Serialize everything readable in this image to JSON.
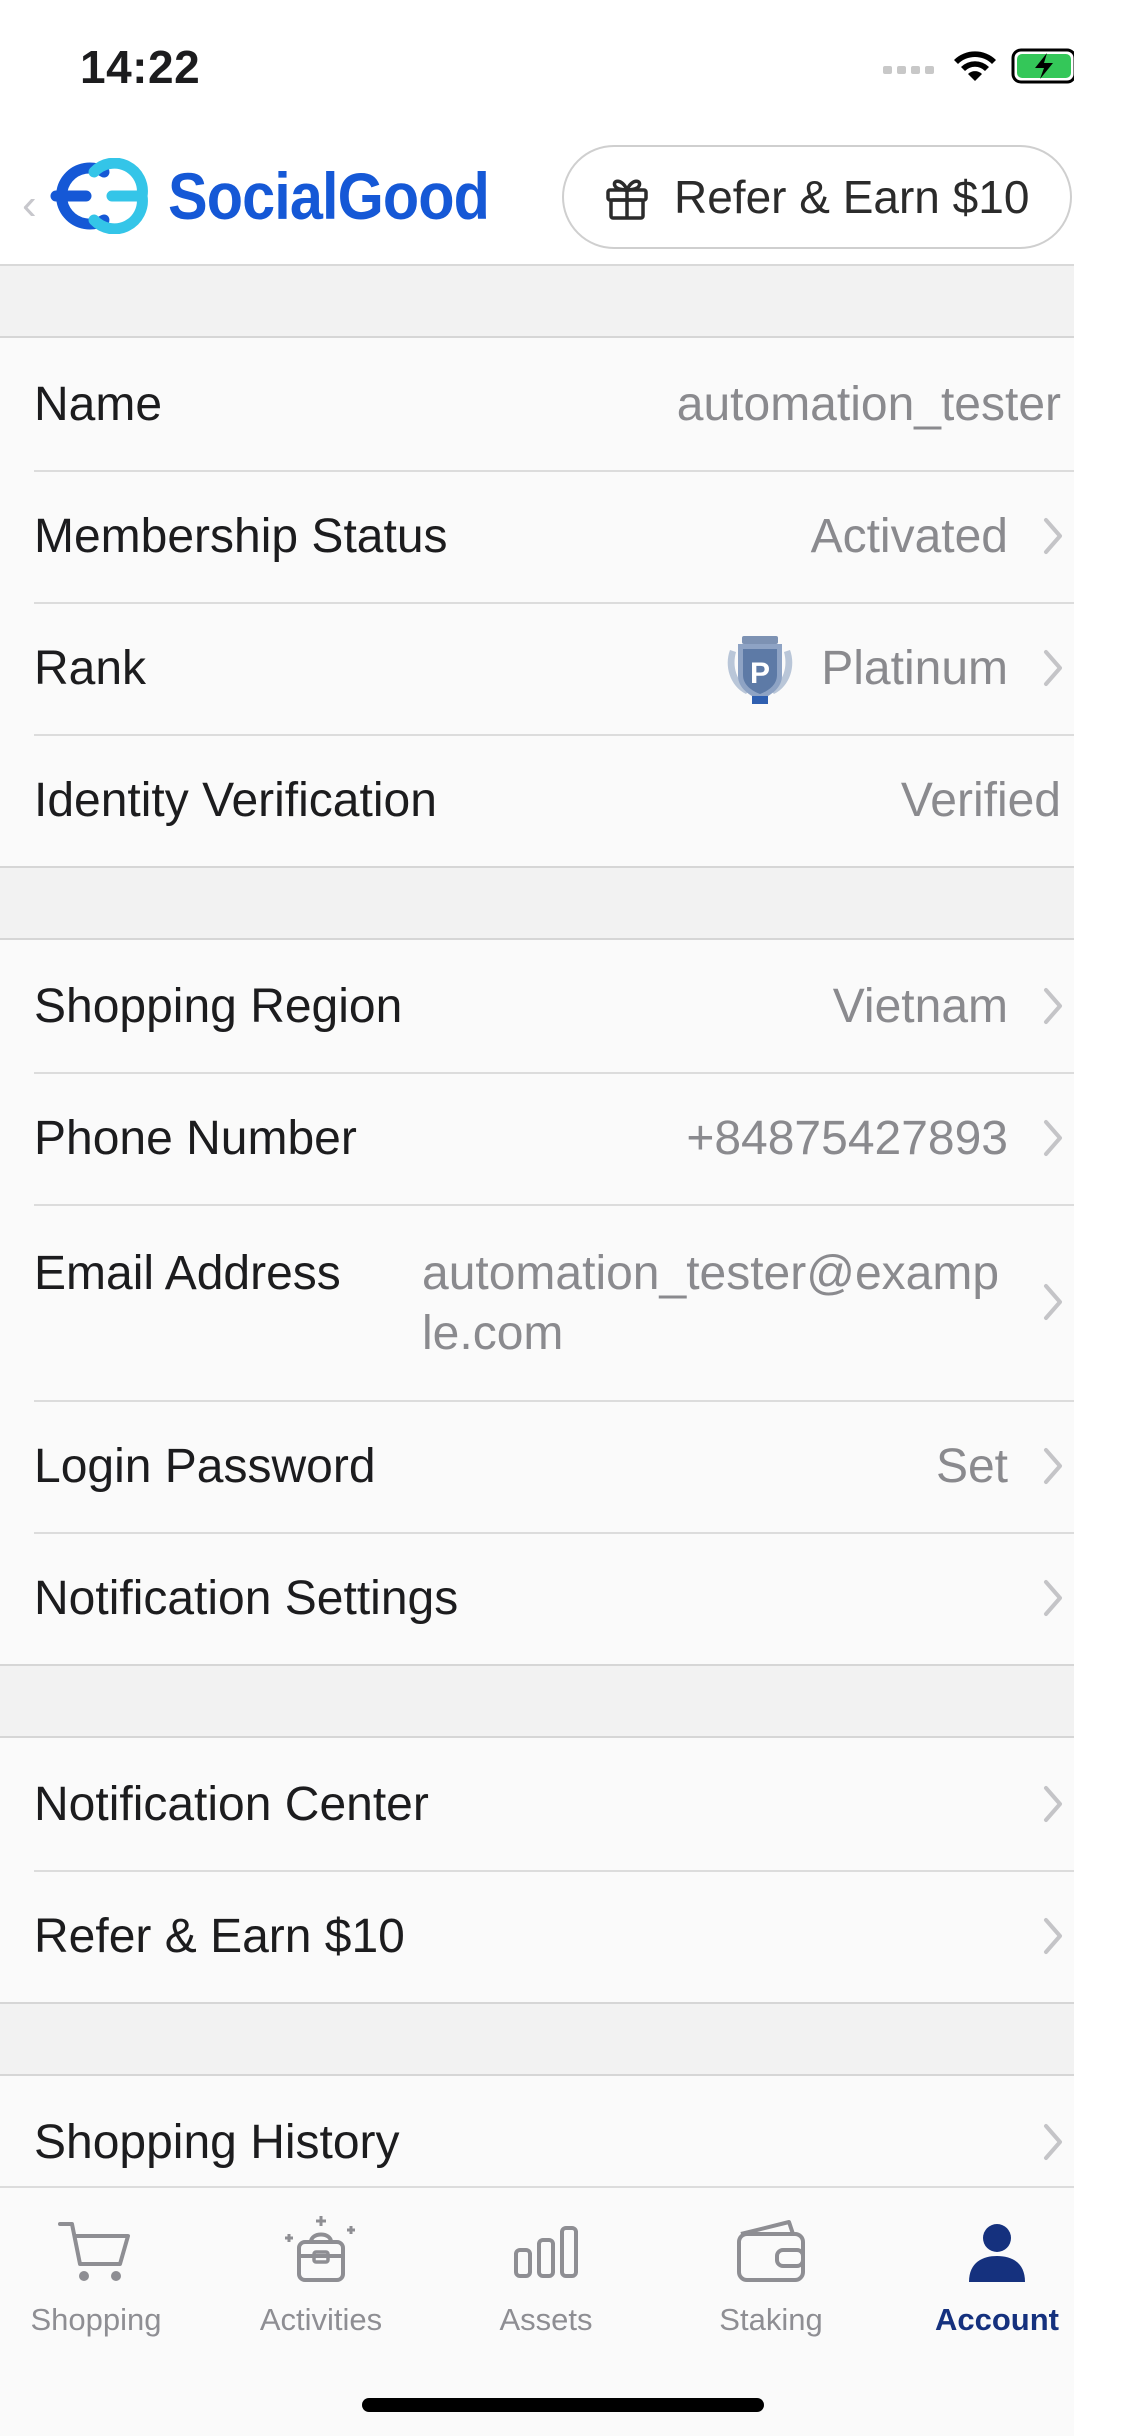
{
  "status_bar": {
    "time": "14:22"
  },
  "header": {
    "brand": "SocialGood",
    "refer_button": "Refer & Earn $10"
  },
  "groups": [
    {
      "rows": [
        {
          "label": "Name",
          "value": "automation_tester",
          "chevron": false
        },
        {
          "label": "Membership Status",
          "value": "Activated",
          "chevron": true
        },
        {
          "label": "Rank",
          "value": "Platinum",
          "chevron": true,
          "badge_letter": "P"
        },
        {
          "label": "Identity Verification",
          "value": "Verified",
          "chevron": false
        }
      ]
    },
    {
      "rows": [
        {
          "label": "Shopping Region",
          "value": "Vietnam",
          "chevron": true
        },
        {
          "label": "Phone Number",
          "value": "+84875427893",
          "chevron": true
        },
        {
          "label": "Email Address",
          "value": "automation_tester@example.com",
          "chevron": true
        },
        {
          "label": "Login Password",
          "value": "Set",
          "chevron": true
        },
        {
          "label": "Notification Settings",
          "value": "",
          "chevron": true
        }
      ]
    },
    {
      "rows": [
        {
          "label": "Notification Center",
          "value": "",
          "chevron": true
        },
        {
          "label": "Refer & Earn $10",
          "value": "",
          "chevron": true
        }
      ]
    },
    {
      "rows": [
        {
          "label": "Shopping History",
          "value": "",
          "chevron": true
        }
      ]
    }
  ],
  "tabs": [
    {
      "label": "Shopping",
      "icon": "cart-icon",
      "active": false
    },
    {
      "label": "Activities",
      "icon": "gift-box-icon",
      "active": false
    },
    {
      "label": "Assets",
      "icon": "bar-chart-icon",
      "active": false
    },
    {
      "label": "Staking",
      "icon": "wallet-icon",
      "active": false
    },
    {
      "label": "Account",
      "icon": "person-icon",
      "active": true
    }
  ],
  "colors": {
    "brand": "#1558d6",
    "active_tab": "#15317e",
    "value_gray": "#8a8a8e",
    "group_bg": "#fafafa",
    "page_bg": "#f2f2f2"
  }
}
